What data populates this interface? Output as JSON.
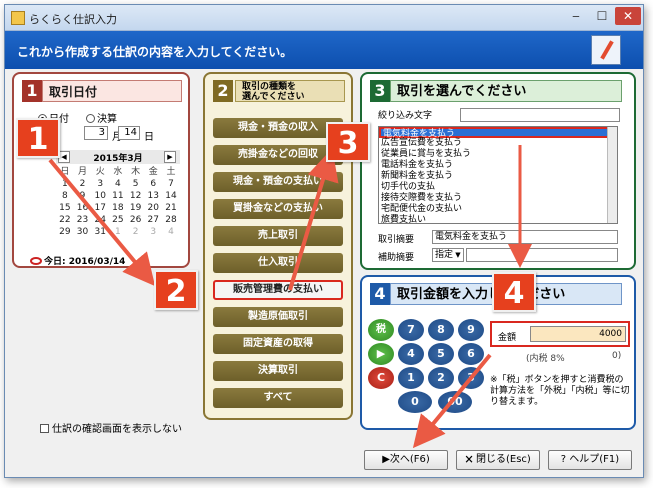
{
  "window": {
    "title": "らくらく仕訳入力",
    "header": "これから作成する仕訳の内容を入力してください。",
    "minimize_icon": "minimize-icon",
    "maximize_icon": "maximize-icon",
    "close_icon": "close-icon"
  },
  "panel1": {
    "num": "1",
    "title": "取引日付",
    "radio_date": "日付",
    "radio_settle": "決算",
    "month_value": "3",
    "month_label": "月",
    "day_value": "14",
    "day_label": "日",
    "calendar": {
      "title": "2015年3月",
      "weekdays": [
        "日",
        "月",
        "火",
        "水",
        "木",
        "金",
        "土"
      ],
      "weeks": [
        [
          "1",
          "2",
          "3",
          "4",
          "5",
          "6",
          "7"
        ],
        [
          "8",
          "9",
          "10",
          "11",
          "12",
          "13",
          "14"
        ],
        [
          "15",
          "16",
          "17",
          "18",
          "19",
          "20",
          "21"
        ],
        [
          "22",
          "23",
          "24",
          "25",
          "26",
          "27",
          "28"
        ],
        [
          "29",
          "30",
          "31",
          "1",
          "2",
          "3",
          "4"
        ]
      ]
    },
    "today": "今日: 2016/03/14"
  },
  "panel2": {
    "num": "2",
    "title_line1": "取引の種類を",
    "title_line2": "選んでください",
    "buttons": [
      "現金・預金の収入",
      "売掛金などの回収",
      "現金・預金の支払い",
      "買掛金などの支払い",
      "売上取引",
      "仕入取引",
      "販売管理費の支払い",
      "製造原価取引",
      "固定資産の取得",
      "決算取引",
      "すべて"
    ],
    "selected_index": 6
  },
  "panel3": {
    "num": "3",
    "title": "取引を選んでください",
    "filter_label": "絞り込み文字",
    "filter_value": "",
    "list_items": [
      "電気料金を支払う",
      "広告宣伝費を支払う",
      "従業員に賞与を支払う",
      "電話料金を支払う",
      "新聞料金を支払う",
      "切手代の支払",
      "接待交際費を支払う",
      "宅配便代金の支払い",
      "旅費支払い"
    ],
    "selected_index": 0,
    "memo_label": "取引摘要",
    "memo_value": "電気料金を支払う",
    "supp_label": "補助摘要",
    "supp_value": "指定",
    "supp_extra": ""
  },
  "panel4": {
    "num": "4",
    "title": "取引金額を入力してください",
    "keys": {
      "tax": "税",
      "k7": "7",
      "k8": "8",
      "k9": "9",
      "k4": "4",
      "k5": "5",
      "k6": "6",
      "k1": "1",
      "k2": "2",
      "k3": "3",
      "k0": "0",
      "k00": "00",
      "clear": "C"
    },
    "amount_label": "金額",
    "amount_value": "4000",
    "tax_label": "(内税 8%",
    "tax_value": "0)",
    "note": "※「税」ボタンを押すと消費税の計算方法を「外税」「内税」等に切り替えます。"
  },
  "confirm_label": "仕訳の確認画面を表示しない",
  "footer": {
    "next": "次へ(F6)",
    "close": "閉じる(Esc)",
    "help": "ヘルプ(F1)"
  },
  "badges": [
    "1",
    "2",
    "3",
    "4"
  ],
  "colors": {
    "header_blue": "#0d4fae",
    "panel1": "#a2473f",
    "panel2": "#8a7634",
    "panel3": "#1d6a34",
    "panel4": "#1e5aa8",
    "highlight": "#d9281f",
    "badge": "#e6401e"
  }
}
